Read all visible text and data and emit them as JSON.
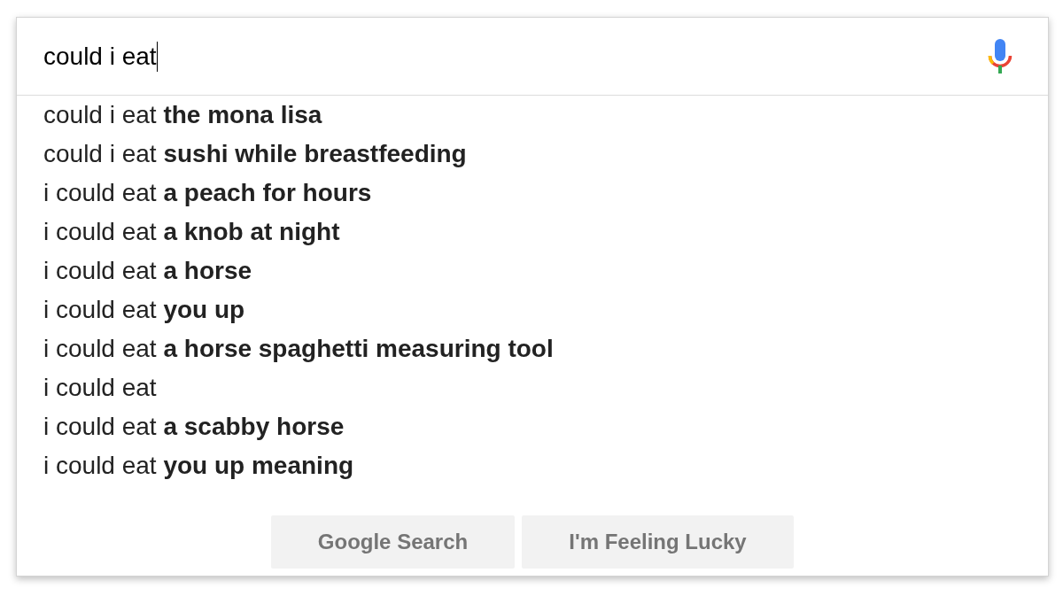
{
  "search": {
    "value": "could i eat",
    "focused": true
  },
  "suggestions": [
    "could i eat **the mona lisa**",
    "could i eat **sushi while breastfeeding**",
    "i could eat **a peach for hours**",
    "i could eat **a knob at night**",
    "i could eat **a horse**",
    "i could eat **you up**",
    "i could eat **a horse spaghetti measuring tool**",
    "i could eat",
    "i could eat **a scabby horse**",
    "i could eat **you up meaning**"
  ],
  "buttons": [
    {
      "label": "Google Search"
    },
    {
      "label": "I'm Feeling Lucky"
    }
  ]
}
